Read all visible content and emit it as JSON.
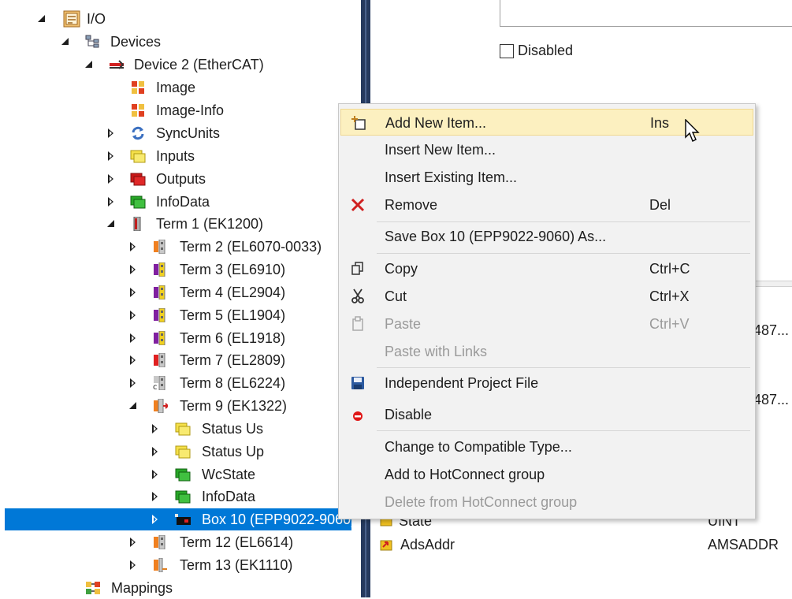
{
  "tree": {
    "items": [
      {
        "label": "I/O"
      },
      {
        "label": "Devices"
      },
      {
        "label": "Device 2 (EtherCAT)"
      },
      {
        "label": "Image"
      },
      {
        "label": "Image-Info"
      },
      {
        "label": "SyncUnits"
      },
      {
        "label": "Inputs"
      },
      {
        "label": "Outputs"
      },
      {
        "label": "InfoData"
      },
      {
        "label": "Term 1 (EK1200)"
      },
      {
        "label": "Term 2 (EL6070-0033)"
      },
      {
        "label": "Term 3 (EL6910)"
      },
      {
        "label": "Term 4 (EL2904)"
      },
      {
        "label": "Term 5 (EL1904)"
      },
      {
        "label": "Term 6 (EL1918)"
      },
      {
        "label": "Term 7 (EL2809)"
      },
      {
        "label": "Term 8 (EL6224)"
      },
      {
        "label": "Term 9 (EK1322)"
      },
      {
        "label": "Status Us"
      },
      {
        "label": "Status Up"
      },
      {
        "label": "WcState"
      },
      {
        "label": "InfoData"
      },
      {
        "label": "Box 10 (EPP9022-9060)"
      },
      {
        "label": "Term 12 (EL6614)"
      },
      {
        "label": "Term 13 (EK1110)"
      },
      {
        "label": "Mappings"
      }
    ]
  },
  "right": {
    "disabled_label": "Disabled",
    "rows": [
      {
        "col": "487..."
      },
      {
        "col": "487..."
      },
      {
        "name": "State",
        "type": "UINT"
      },
      {
        "name": "AdsAddr",
        "type": "AMSADDR"
      }
    ]
  },
  "menu": {
    "items": [
      {
        "label": "Add New Item...",
        "shortcut": "Ins"
      },
      {
        "label": "Insert New Item...",
        "shortcut": ""
      },
      {
        "label": "Insert Existing Item...",
        "shortcut": ""
      },
      {
        "label": "Remove",
        "shortcut": "Del"
      },
      {
        "label": "Save Box 10 (EPP9022-9060) As...",
        "shortcut": ""
      },
      {
        "label": "Copy",
        "shortcut": "Ctrl+C"
      },
      {
        "label": "Cut",
        "shortcut": "Ctrl+X"
      },
      {
        "label": "Paste",
        "shortcut": "Ctrl+V"
      },
      {
        "label": "Paste with Links",
        "shortcut": ""
      },
      {
        "label": "Independent Project File",
        "shortcut": ""
      },
      {
        "label": "Disable",
        "shortcut": ""
      },
      {
        "label": "Change to Compatible Type...",
        "shortcut": ""
      },
      {
        "label": "Add to HotConnect group",
        "shortcut": ""
      },
      {
        "label": "Delete from HotConnect group",
        "shortcut": ""
      }
    ]
  },
  "colors": {
    "selection": "#0078d7",
    "menu_highlight": "#fcf0c0",
    "splitter": "#263a5e"
  }
}
